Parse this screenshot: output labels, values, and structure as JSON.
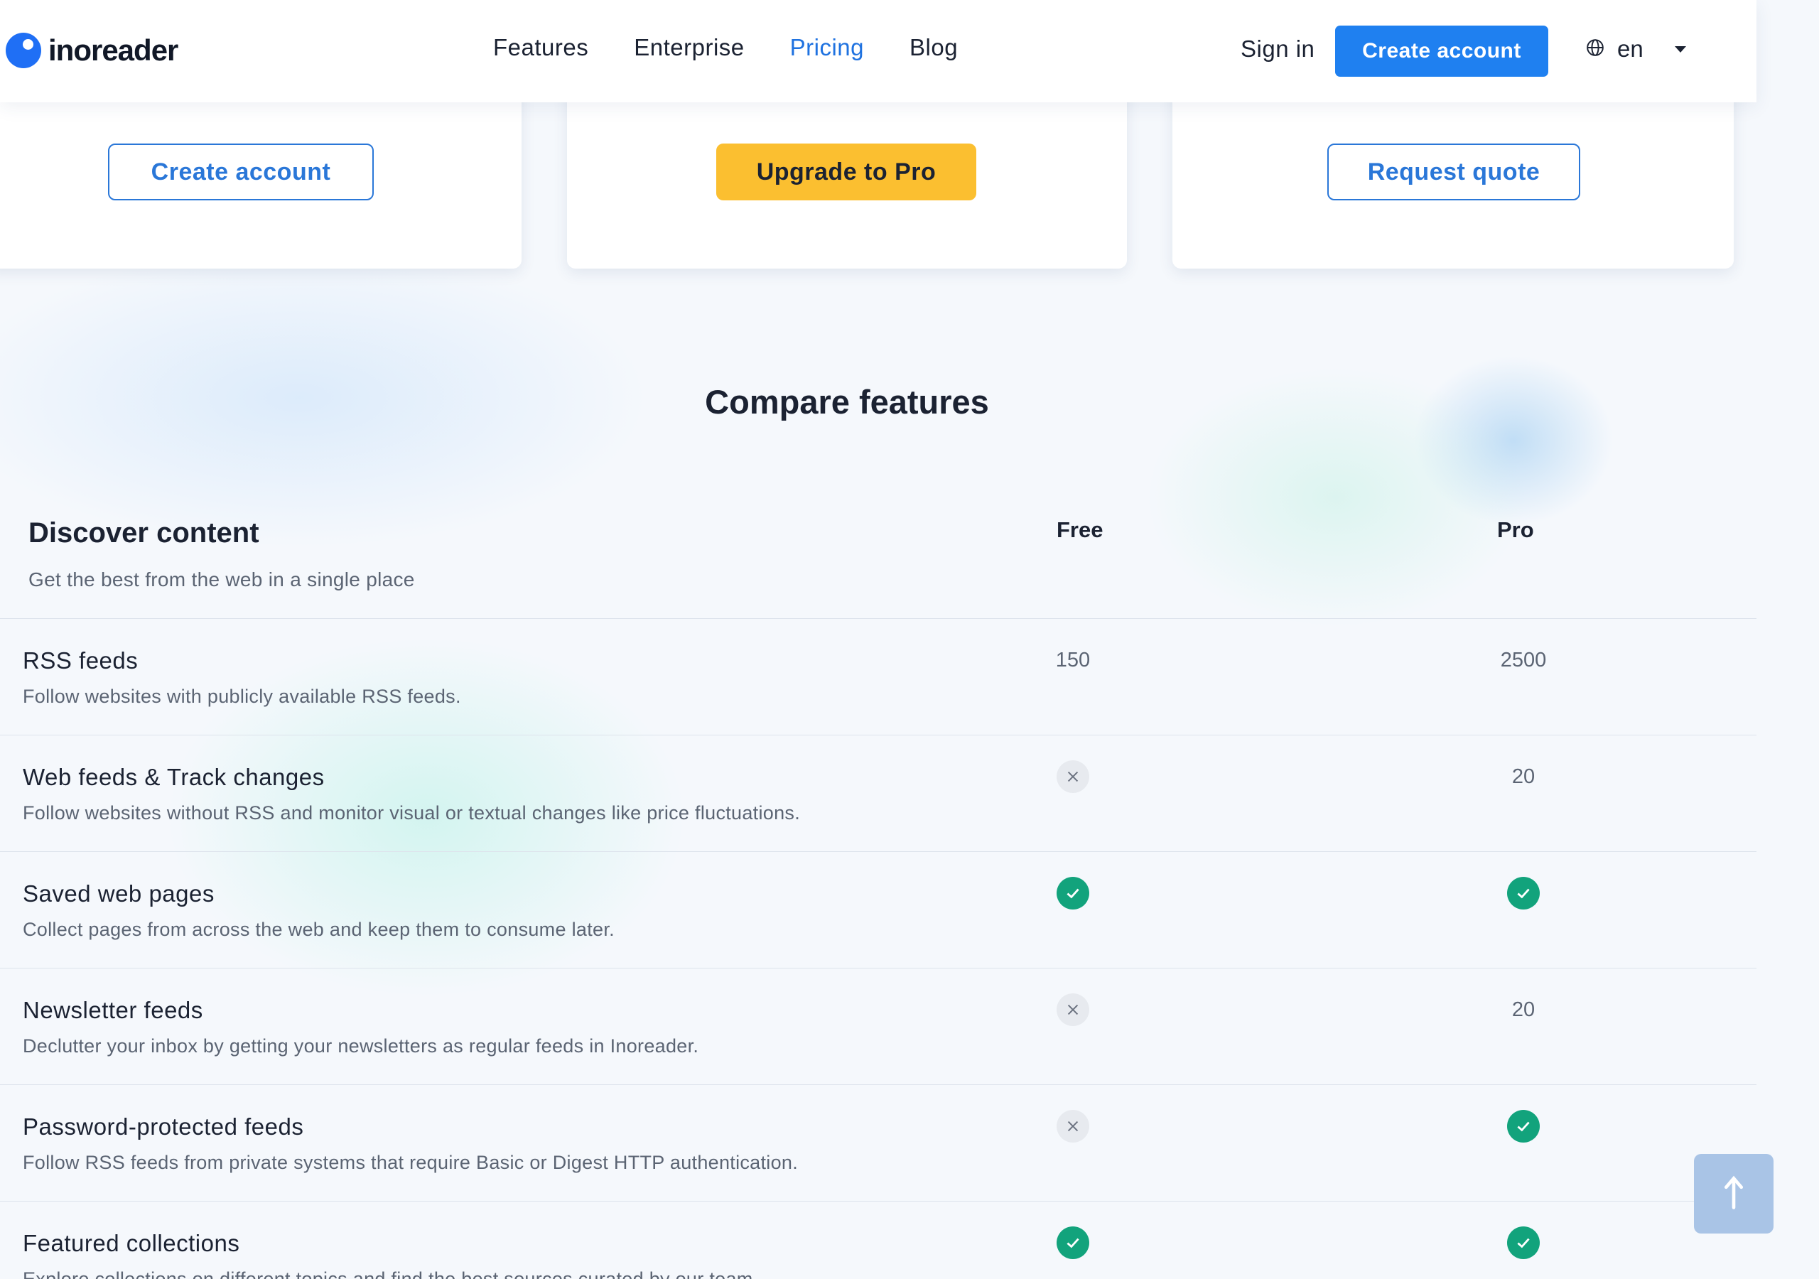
{
  "header": {
    "logo_text": "inoreader",
    "nav": [
      "Features",
      "Enterprise",
      "Pricing",
      "Blog"
    ],
    "active_nav": "Pricing",
    "sign_in": "Sign in",
    "create_account": "Create account",
    "language": "en"
  },
  "plans": [
    {
      "button": "Create account",
      "style": "outline"
    },
    {
      "button": "Upgrade to Pro",
      "style": "yellow"
    },
    {
      "button": "Request quote",
      "style": "outline"
    }
  ],
  "compare": {
    "title": "Compare features",
    "group_title": "Discover content",
    "group_subtitle": "Get the best from the web in a single place",
    "columns": [
      "Free",
      "Pro"
    ],
    "rows": [
      {
        "title": "RSS feeds",
        "desc": "Follow websites with publicly available RSS feeds.",
        "free": "150",
        "pro": "2500"
      },
      {
        "title": "Web feeds & Track changes",
        "desc": "Follow websites without RSS and monitor visual or textual changes like price fluctuations.",
        "free": "no",
        "pro": "20"
      },
      {
        "title": "Saved web pages",
        "desc": "Collect pages from across the web and keep them to consume later.",
        "free": "yes",
        "pro": "yes"
      },
      {
        "title": "Newsletter feeds",
        "desc": "Declutter your inbox by getting your newsletters as regular feeds in Inoreader.",
        "free": "no",
        "pro": "20"
      },
      {
        "title": "Password-protected feeds",
        "desc": "Follow RSS feeds from private systems that require Basic or Digest HTTP authentication.",
        "free": "no",
        "pro": "yes"
      },
      {
        "title": "Featured collections",
        "desc": "Explore collections on different topics and find the best sources curated by our team.",
        "free": "yes",
        "pro": "yes"
      }
    ]
  },
  "colors": {
    "accent": "#1f80f0",
    "active_link": "#1f72e0",
    "upgrade": "#fbbf30",
    "check": "#12a37c",
    "cross_bg": "#e7eaef"
  },
  "icons": {
    "yes": "check-circle-icon",
    "no": "x-circle-icon",
    "language": "globe-icon",
    "back_to_top": "arrow-up-icon"
  }
}
